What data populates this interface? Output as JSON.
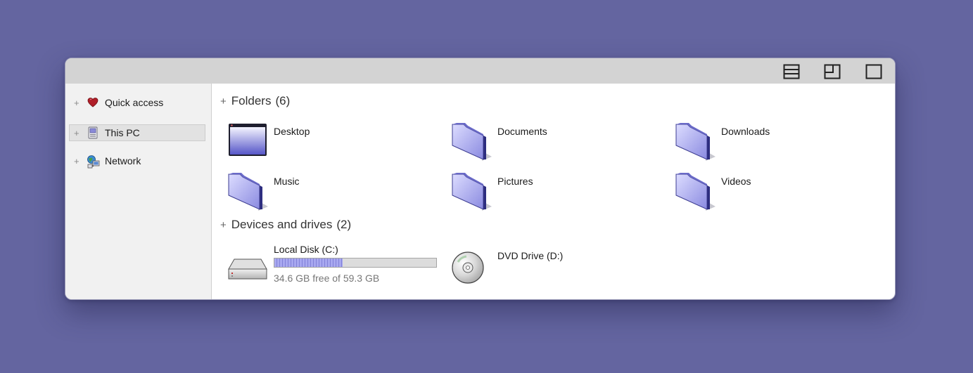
{
  "window": {
    "controls": [
      {
        "name": "layout-rows-icon"
      },
      {
        "name": "restore-icon"
      },
      {
        "name": "maximize-icon"
      }
    ]
  },
  "sidebar": {
    "items": [
      {
        "label": "Quick access",
        "icon": "heart-icon",
        "selected": false
      },
      {
        "label": "This PC",
        "icon": "computer-icon",
        "selected": true
      },
      {
        "label": "Network",
        "icon": "network-icon",
        "selected": false
      }
    ]
  },
  "folders": {
    "title": "Folders",
    "count": "(6)",
    "items": [
      {
        "label": "Desktop",
        "icon": "desktop-window-icon"
      },
      {
        "label": "Documents",
        "icon": "folder-icon"
      },
      {
        "label": "Downloads",
        "icon": "folder-icon"
      },
      {
        "label": "Music",
        "icon": "folder-icon"
      },
      {
        "label": "Pictures",
        "icon": "folder-icon"
      },
      {
        "label": "Videos",
        "icon": "folder-icon"
      }
    ]
  },
  "devices": {
    "title": "Devices and drives",
    "count": "(2)",
    "items": [
      {
        "label": "Local Disk (C:)",
        "icon": "hard-drive-icon",
        "free_text": "34.6 GB free of 59.3 GB",
        "used_fraction": 0.42
      },
      {
        "label": "DVD Drive (D:)",
        "icon": "dvd-disc-icon"
      }
    ]
  },
  "colors": {
    "background": "#6465a0",
    "folder": "#9c9ce8",
    "drive_fill": "#a8a8f0"
  }
}
